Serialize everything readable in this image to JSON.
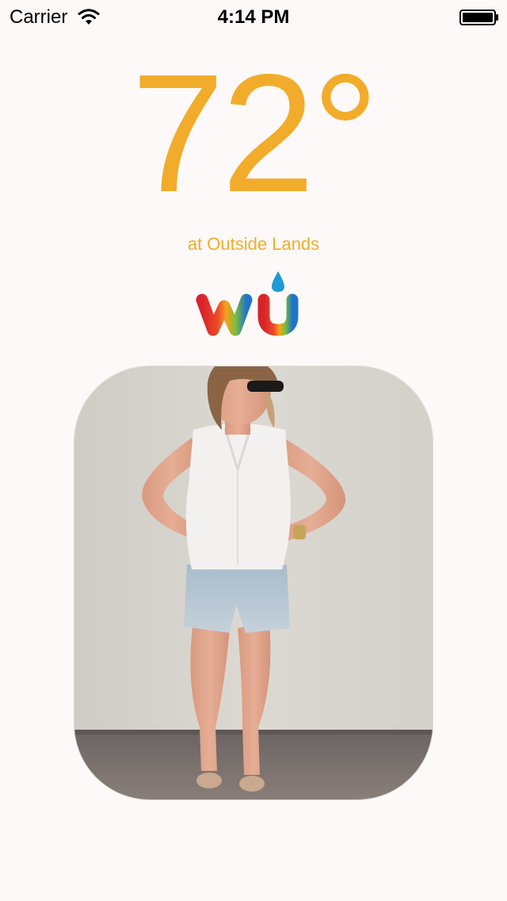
{
  "status_bar": {
    "carrier": "Carrier",
    "time": "4:14 PM",
    "wifi_icon": "wifi-icon",
    "battery_icon": "battery-icon"
  },
  "weather": {
    "temperature": "72°",
    "location": "at Outside Lands"
  },
  "logo": {
    "icon": "weather-underground-logo"
  },
  "photo": {
    "subject": "outfit-photo"
  },
  "colors": {
    "accent": "#f2ac2b",
    "background": "#fdf9f8"
  }
}
